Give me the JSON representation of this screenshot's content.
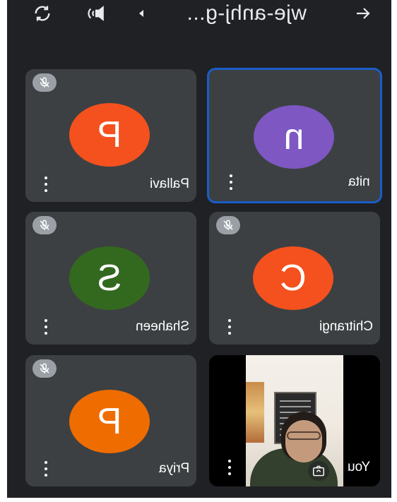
{
  "header": {
    "title": "wje-anhj-g...",
    "icons": {
      "back": "arrow-back-icon",
      "chevron": "chevron-icon",
      "speaker": "speaker-icon",
      "switch_camera": "switch-camera-icon"
    }
  },
  "participants": [
    {
      "name": "Pallavi",
      "initial": "P",
      "avatar_color": "#f4511e",
      "muted": true,
      "active": false
    },
    {
      "name": "nita",
      "initial": "n",
      "avatar_color": "#7e57c2",
      "muted": false,
      "active": true
    },
    {
      "name": "Shaheen",
      "initial": "S",
      "avatar_color": "#33691e",
      "muted": true,
      "active": false
    },
    {
      "name": "Chitrangi",
      "initial": "C",
      "avatar_color": "#f4511e",
      "muted": true,
      "active": false
    },
    {
      "name": "Priya",
      "initial": "P",
      "avatar_color": "#ef6c00",
      "muted": true,
      "active": false
    },
    {
      "name": "You",
      "video": true,
      "muted": false,
      "active": false
    }
  ],
  "colors": {
    "background": "#202124",
    "tile": "#3c4043",
    "active_border": "#1a5ec8",
    "mute_badge": "#9aa0a6"
  }
}
